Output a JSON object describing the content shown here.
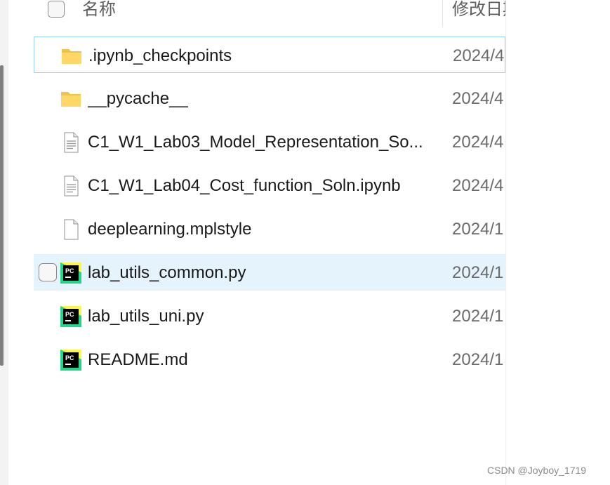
{
  "header": {
    "name_column": "名称",
    "date_column": "修改日期"
  },
  "files": [
    {
      "name": ".ipynb_checkpoints",
      "date": "2024/4",
      "icon": "folder-icon",
      "state": "focused"
    },
    {
      "name": "__pycache__",
      "date": "2024/4",
      "icon": "folder-icon",
      "state": ""
    },
    {
      "name": "C1_W1_Lab03_Model_Representation_So...",
      "date": "2024/4",
      "icon": "notebook-file-icon",
      "state": ""
    },
    {
      "name": "C1_W1_Lab04_Cost_function_Soln.ipynb",
      "date": "2024/4",
      "icon": "notebook-file-icon",
      "state": ""
    },
    {
      "name": "deeplearning.mplstyle",
      "date": "2024/1",
      "icon": "blank-file-icon",
      "state": ""
    },
    {
      "name": "lab_utils_common.py",
      "date": "2024/1",
      "icon": "pycharm-file-icon",
      "state": "hovered"
    },
    {
      "name": "lab_utils_uni.py",
      "date": "2024/1",
      "icon": "pycharm-file-icon",
      "state": ""
    },
    {
      "name": "README.md",
      "date": "2024/1",
      "icon": "pycharm-file-icon",
      "state": ""
    }
  ],
  "watermark": "CSDN @Joyboy_1719"
}
